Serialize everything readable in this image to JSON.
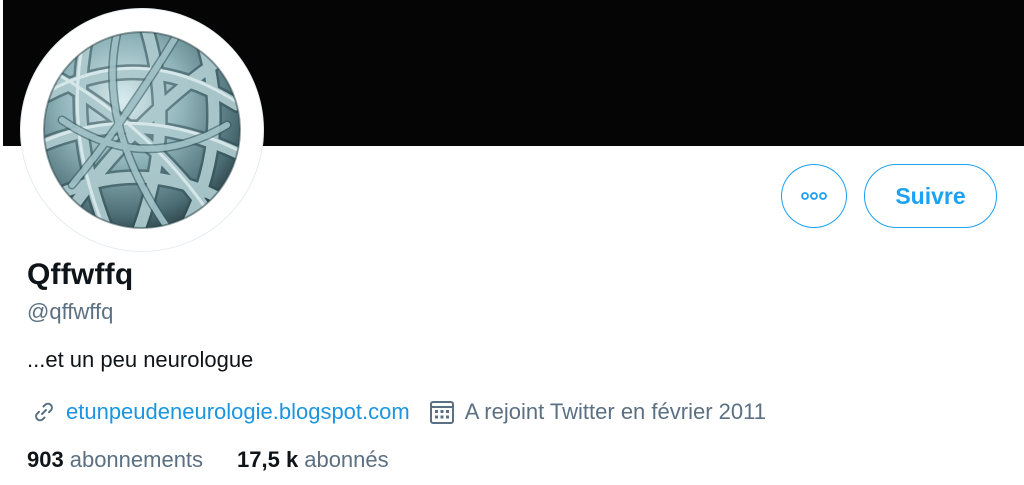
{
  "profile": {
    "display_name": "Qffwffq",
    "handle": "@qffwffq",
    "bio": "...et un peu neurologue",
    "website": "etunpeudeneurologie.blogspot.com",
    "joined": "A rejoint Twitter en février 2011"
  },
  "stats": {
    "following_count": "903",
    "following_label": "abonnements",
    "followers_count": "17,5 k",
    "followers_label": "abonnés"
  },
  "actions": {
    "follow_label": "Suivre",
    "more_icon": "more-dots-icon"
  },
  "icons": {
    "link": "link-icon",
    "calendar": "calendar-icon"
  },
  "colors": {
    "accent": "#1da1f2",
    "link": "#1b95e0",
    "secondary_text": "#5b7083",
    "primary_text": "#0f1419",
    "banner": "#050505"
  }
}
